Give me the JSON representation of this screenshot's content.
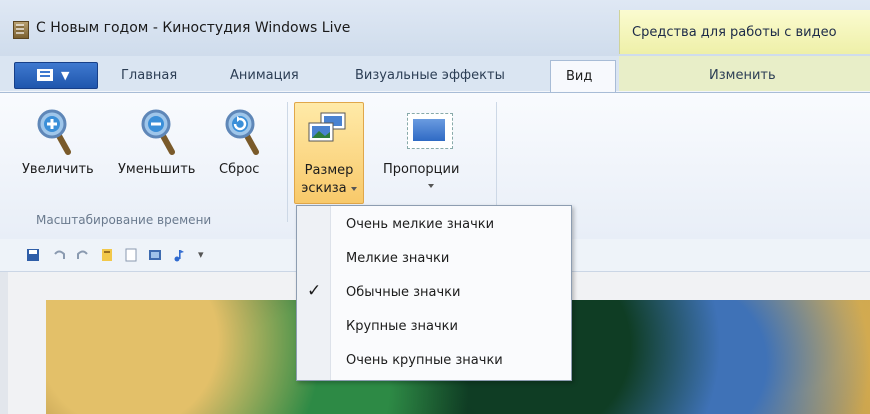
{
  "window": {
    "title": "С Новым годом - Киностудия Windows Live",
    "context_group": "Средства для работы с видео"
  },
  "tabs": [
    {
      "label": "Главная"
    },
    {
      "label": "Анимация"
    },
    {
      "label": "Визуальные эффекты"
    },
    {
      "label": "Вид",
      "active": true
    },
    {
      "label": "Изменить"
    }
  ],
  "ribbon": {
    "zoom_group": {
      "label": "Масштабирование времени",
      "buttons": [
        {
          "label": "Увеличить",
          "icon": "zoom-in-icon"
        },
        {
          "label": "Уменьшить",
          "icon": "zoom-out-icon"
        },
        {
          "label": "Сброс",
          "icon": "zoom-reset-icon"
        }
      ]
    },
    "thumbnail_size": {
      "line1": "Размер",
      "line2": "эскиза"
    },
    "aspect_ratio": {
      "label": "Пропорции"
    }
  },
  "menu": {
    "items": [
      {
        "label": "Очень мелкие значки",
        "checked": false
      },
      {
        "label": "Мелкие значки",
        "checked": false
      },
      {
        "label": "Обычные значки",
        "checked": true
      },
      {
        "label": "Крупные значки",
        "checked": false
      },
      {
        "label": "Очень крупные значки",
        "checked": false
      }
    ],
    "check_glyph": "✓"
  },
  "colors": {
    "accent": "#1f56ad",
    "context_tab": "#eef0a8",
    "highlight": "#f8c96a"
  }
}
